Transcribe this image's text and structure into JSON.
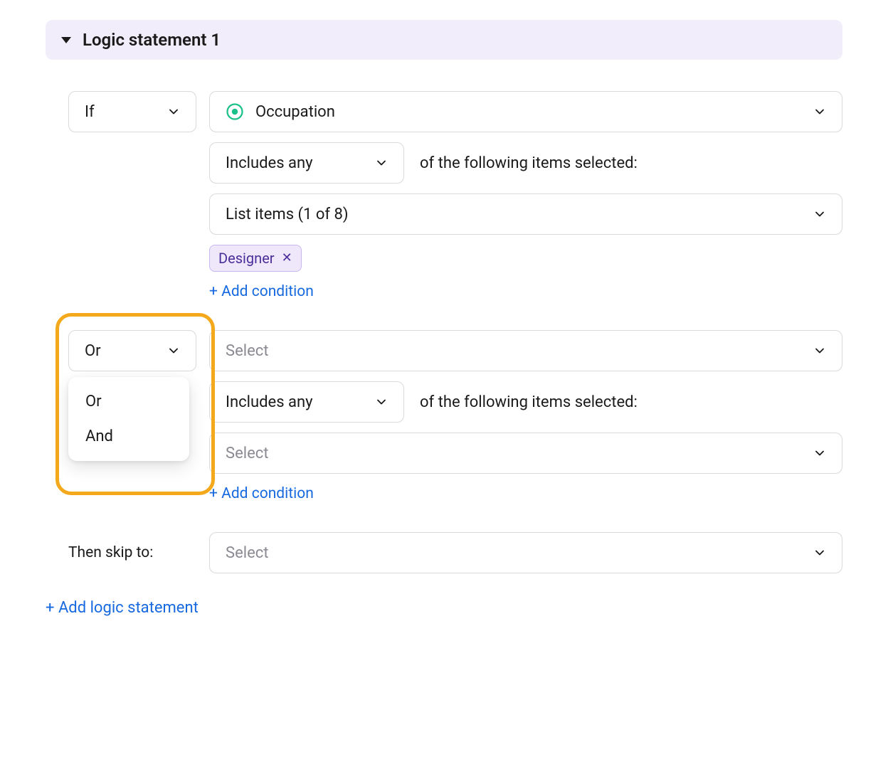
{
  "header": {
    "title": "Logic statement 1"
  },
  "condition1": {
    "connector": "If",
    "question_label": "Occupation",
    "operator": "Includes any",
    "helper": "of the following items selected:",
    "list_label": "List items (1 of 8)",
    "chip": "Designer",
    "add_condition": "+ Add condition"
  },
  "condition2": {
    "connector": "Or",
    "dropdown": {
      "opt1": "Or",
      "opt2": "And"
    },
    "question_placeholder": "Select",
    "operator": "Includes any",
    "helper": "of the following items selected:",
    "list_placeholder": "Select",
    "add_condition": "+ Add condition"
  },
  "then": {
    "label": "Then skip to:",
    "placeholder": "Select"
  },
  "footer": {
    "add_statement": "+ Add logic statement"
  }
}
